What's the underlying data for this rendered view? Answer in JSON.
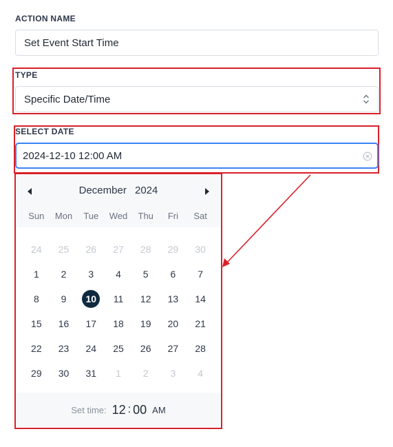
{
  "action_name": {
    "label": "ACTION NAME",
    "value": "Set Event Start Time"
  },
  "type": {
    "label": "TYPE",
    "selected": "Specific Date/Time"
  },
  "select_date": {
    "label": "SELECT DATE",
    "value": "2024-12-10 12:00 AM"
  },
  "calendar": {
    "month": "December",
    "year": "2024",
    "weekdays": [
      "Sun",
      "Mon",
      "Tue",
      "Wed",
      "Thu",
      "Fri",
      "Sat"
    ],
    "days": [
      {
        "n": "24",
        "muted": true
      },
      {
        "n": "25",
        "muted": true
      },
      {
        "n": "26",
        "muted": true
      },
      {
        "n": "27",
        "muted": true
      },
      {
        "n": "28",
        "muted": true
      },
      {
        "n": "29",
        "muted": true
      },
      {
        "n": "30",
        "muted": true
      },
      {
        "n": "1"
      },
      {
        "n": "2"
      },
      {
        "n": "3"
      },
      {
        "n": "4"
      },
      {
        "n": "5"
      },
      {
        "n": "6"
      },
      {
        "n": "7"
      },
      {
        "n": "8"
      },
      {
        "n": "9"
      },
      {
        "n": "10",
        "selected": true
      },
      {
        "n": "11"
      },
      {
        "n": "12"
      },
      {
        "n": "13"
      },
      {
        "n": "14"
      },
      {
        "n": "15"
      },
      {
        "n": "16"
      },
      {
        "n": "17"
      },
      {
        "n": "18"
      },
      {
        "n": "19"
      },
      {
        "n": "20"
      },
      {
        "n": "21"
      },
      {
        "n": "22"
      },
      {
        "n": "23"
      },
      {
        "n": "24"
      },
      {
        "n": "25"
      },
      {
        "n": "26"
      },
      {
        "n": "27"
      },
      {
        "n": "28"
      },
      {
        "n": "29"
      },
      {
        "n": "30"
      },
      {
        "n": "31"
      },
      {
        "n": "1",
        "muted": true
      },
      {
        "n": "2",
        "muted": true
      },
      {
        "n": "3",
        "muted": true
      },
      {
        "n": "4",
        "muted": true
      }
    ],
    "time": {
      "label": "Set time:",
      "hour": "12",
      "separator": ":",
      "minute": "00",
      "period": "AM"
    }
  },
  "colors": {
    "highlight": "#d9202a",
    "selected_day": "#0f2a3f",
    "focus_border": "#3b82f6"
  }
}
